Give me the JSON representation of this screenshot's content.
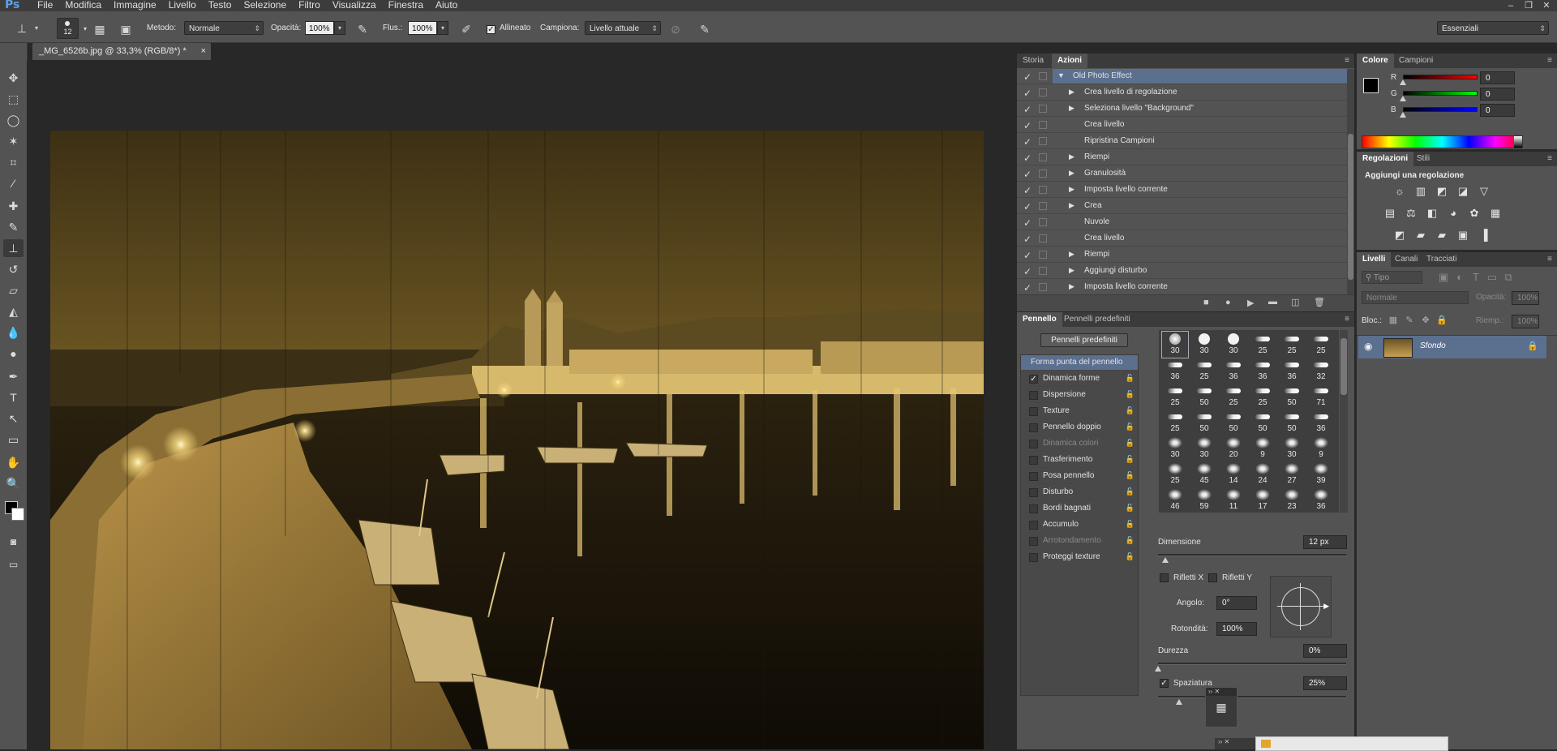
{
  "app": {
    "logo": "Ps",
    "menus": [
      "File",
      "Modifica",
      "Immagine",
      "Livello",
      "Testo",
      "Selezione",
      "Filtro",
      "Visualizza",
      "Finestra",
      "Aiuto"
    ],
    "window_controls": [
      "–",
      "❐",
      "✕"
    ]
  },
  "options_bar": {
    "brush_size": "12",
    "metodo_label": "Metodo:",
    "metodo_value": "Normale",
    "opacita_label": "Opacità:",
    "opacita_value": "100%",
    "flusso_label": "Flus.:",
    "flusso_value": "100%",
    "allineato_label": "Allineato",
    "campiona_label": "Campiona:",
    "campiona_value": "Livello attuale",
    "workspace_value": "Essenziali"
  },
  "document": {
    "tab_title": "_MG_6526b.jpg @ 33,3% (RGB/8*) *",
    "tab_close": "×"
  },
  "actions_panel": {
    "tabs": [
      "Storia",
      "Azioni"
    ],
    "active_tab": "Azioni",
    "rows": [
      {
        "label": "Old Photo Effect",
        "level": 0,
        "arrow": "▼",
        "selected": true
      },
      {
        "label": "Crea livello di regolazione",
        "level": 1,
        "arrow": "▶"
      },
      {
        "label": "Seleziona livello \"Background\"",
        "level": 1,
        "arrow": "▶"
      },
      {
        "label": "Crea livello",
        "level": 1,
        "arrow": ""
      },
      {
        "label": "Ripristina Campioni",
        "level": 1,
        "arrow": ""
      },
      {
        "label": "Riempi",
        "level": 1,
        "arrow": "▶"
      },
      {
        "label": "Granulosità",
        "level": 1,
        "arrow": "▶"
      },
      {
        "label": "Imposta livello corrente",
        "level": 1,
        "arrow": "▶"
      },
      {
        "label": "Crea",
        "level": 1,
        "arrow": "▶"
      },
      {
        "label": "Nuvole",
        "level": 1,
        "arrow": ""
      },
      {
        "label": "Crea livello",
        "level": 1,
        "arrow": ""
      },
      {
        "label": "Riempi",
        "level": 1,
        "arrow": "▶"
      },
      {
        "label": "Aggiungi disturbo",
        "level": 1,
        "arrow": "▶"
      },
      {
        "label": "Imposta livello corrente",
        "level": 1,
        "arrow": "▶"
      }
    ],
    "footer_icons": [
      "stop-icon",
      "record-icon",
      "play-icon",
      "new-set-icon",
      "new-action-icon",
      "trash-icon"
    ]
  },
  "brush_panel": {
    "tabs": [
      "Pennello",
      "Pennelli predefiniti"
    ],
    "active_tab": "Pennello",
    "preset_button": "Pennelli predefiniti",
    "options": [
      {
        "label": "Forma punta del pennello",
        "checkbox": false,
        "header": true
      },
      {
        "label": "Dinamica forme",
        "checked": true
      },
      {
        "label": "Dispersione",
        "checked": false
      },
      {
        "label": "Texture",
        "checked": false
      },
      {
        "label": "Pennello doppio",
        "checked": false
      },
      {
        "label": "Dinamica colori",
        "checked": false,
        "dim": true
      },
      {
        "label": "Trasferimento",
        "checked": false
      },
      {
        "label": "Posa pennello",
        "checked": false
      },
      {
        "label": "Disturbo",
        "checked": false
      },
      {
        "label": "Bordi bagnati",
        "checked": false
      },
      {
        "label": "Accumulo",
        "checked": false
      },
      {
        "label": "Arrotondamento",
        "checked": false,
        "dim": true
      },
      {
        "label": "Proteggi texture",
        "checked": false
      }
    ],
    "tip_sizes": [
      [
        "30",
        "30",
        "30",
        "25",
        "25",
        "25"
      ],
      [
        "36",
        "25",
        "36",
        "36",
        "36",
        "32"
      ],
      [
        "25",
        "50",
        "25",
        "25",
        "50",
        "71"
      ],
      [
        "25",
        "50",
        "50",
        "50",
        "50",
        "36"
      ],
      [
        "30",
        "30",
        "20",
        "9",
        "30",
        "9"
      ],
      [
        "25",
        "45",
        "14",
        "24",
        "27",
        "39"
      ],
      [
        "46",
        "59",
        "11",
        "17",
        "23",
        "36"
      ]
    ],
    "dimensione_label": "Dimensione",
    "dimensione_value": "12 px",
    "rifletti_x": "Rifletti X",
    "rifletti_y": "Rifletti Y",
    "angolo_label": "Angolo:",
    "angolo_value": "0°",
    "rotondita_label": "Rotondità:",
    "rotondita_value": "100%",
    "durezza_label": "Durezza",
    "durezza_value": "0%",
    "spaziatura_label": "Spaziatura",
    "spaziatura_value": "25%"
  },
  "color_panel": {
    "tabs": [
      "Colore",
      "Campioni"
    ],
    "active_tab": "Colore",
    "channels": [
      {
        "name": "R",
        "value": "0"
      },
      {
        "name": "G",
        "value": "0"
      },
      {
        "name": "B",
        "value": "0"
      }
    ]
  },
  "adjustments_panel": {
    "tabs": [
      "Regolazioni",
      "Stili"
    ],
    "active_tab": "Regolazioni",
    "heading": "Aggiungi una regolazione"
  },
  "layers_panel": {
    "tabs": [
      "Livelli",
      "Canali",
      "Tracciati"
    ],
    "active_tab": "Livelli",
    "filter_label": "Tipo",
    "blend_mode": "Normale",
    "opacity_label": "Opacità:",
    "opacity_value": "100%",
    "lock_label": "Bloc.:",
    "fill_label": "Riemp.:",
    "fill_value": "100%",
    "layers": [
      {
        "name": "Sfondo",
        "locked": true
      }
    ]
  }
}
